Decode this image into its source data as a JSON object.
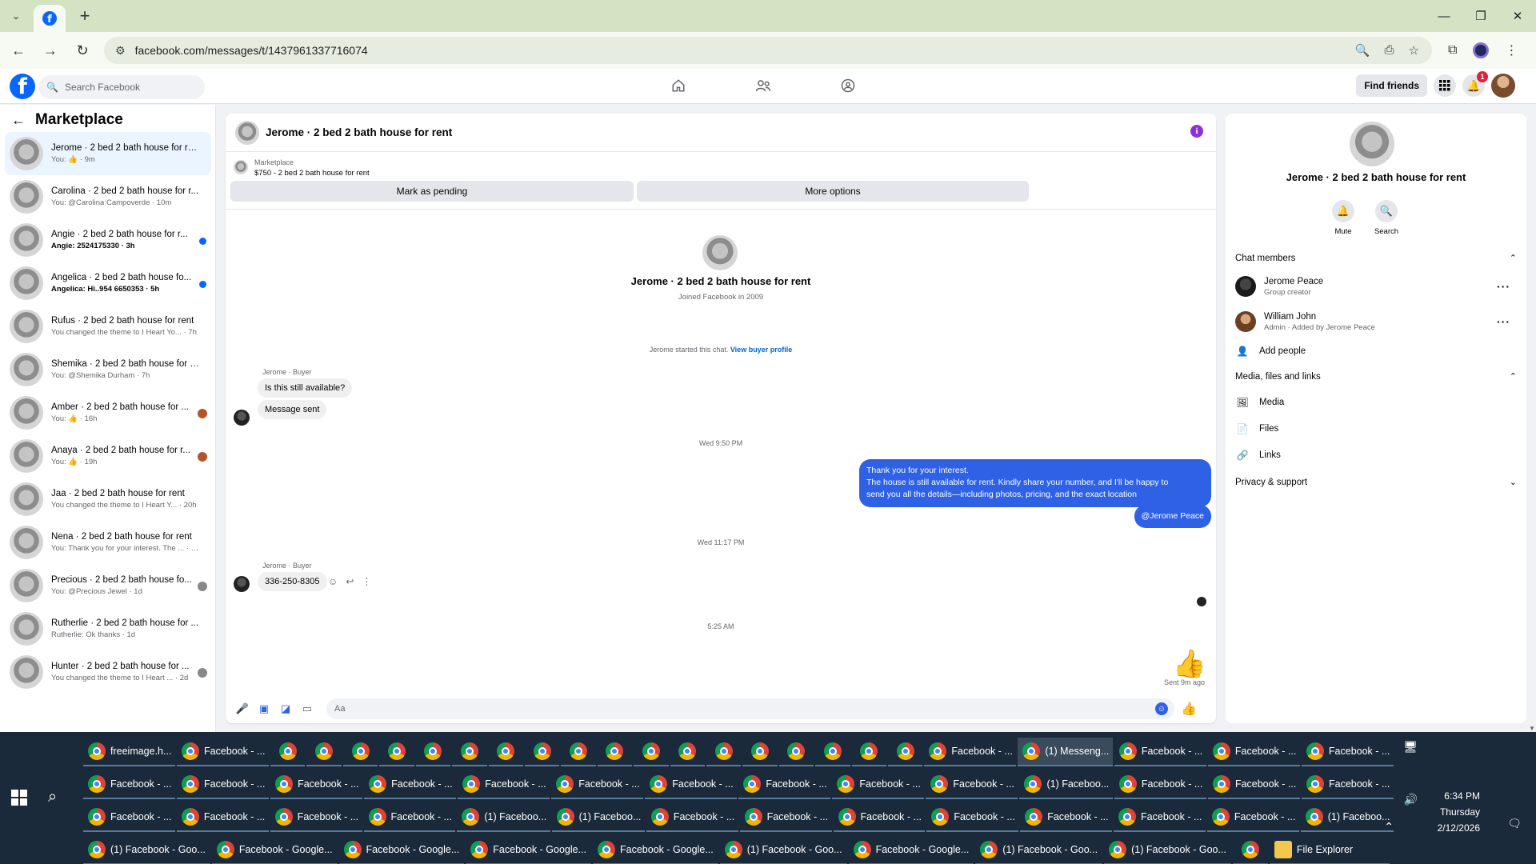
{
  "browser": {
    "url": "facebook.com/messages/t/1437961337716074"
  },
  "fb_header": {
    "search_placeholder": "Search Facebook",
    "find_friends": "Find friends",
    "notif_count": "1"
  },
  "sidebar": {
    "title": "Marketplace",
    "conversations": [
      {
        "name": "Jerome · 2 bed 2 bath house for rent",
        "snippet": "You: 👍 · 9m",
        "unread": false,
        "active": true
      },
      {
        "name": "Carolina · 2 bed 2 bath house for r...",
        "snippet": "You: @Carolina Campoverde · 10m",
        "unread": false
      },
      {
        "name": "Angie · 2 bed 2 bath house for r...",
        "snippet": "Angie: 2524175330 · 3h",
        "unread": true
      },
      {
        "name": "Angelica · 2 bed 2 bath house fo...",
        "snippet": "Angelica: Hi..954 6650353 · 5h",
        "unread": true
      },
      {
        "name": "Rufus · 2 bed 2 bath house for rent",
        "snippet": "You changed the theme to I Heart Yo... · 7h",
        "unread": false
      },
      {
        "name": "Shemika · 2 bed 2 bath house for r...",
        "snippet": "You: @Shemika Durham · 7h",
        "unread": false
      },
      {
        "name": "Amber · 2 bed 2 bath house for ...",
        "snippet": "You: 👍 · 16h",
        "unread": false
      },
      {
        "name": "Anaya · 2 bed 2 bath house for r...",
        "snippet": "You: 👍 · 19h",
        "unread": false
      },
      {
        "name": "Jaa · 2 bed 2 bath house for rent",
        "snippet": "You changed the theme to I Heart Y... · 20h",
        "unread": false
      },
      {
        "name": "Nena · 2 bed 2 bath house for rent",
        "snippet": "You: Thank you for your interest. The ... · 1d",
        "unread": false
      },
      {
        "name": "Precious · 2 bed 2 bath house fo...",
        "snippet": "You: @Precious Jewel · 1d",
        "unread": false
      },
      {
        "name": "Rutherlie · 2 bed 2 bath house for ...",
        "snippet": "Rutherlie: Ok thanks · 1d",
        "unread": false
      },
      {
        "name": "Hunter · 2 bed 2 bath house for ...",
        "snippet": "You changed the theme to I Heart ... · 2d",
        "unread": false
      }
    ]
  },
  "chat": {
    "title": "Jerome · 2 bed 2 bath house for rent",
    "marketplace_label": "Marketplace",
    "listing": "$750 - 2 bed 2 bath house for rent",
    "mark_pending": "Mark as pending",
    "more_options": "More options",
    "intro_name": "Jerome · 2 bed 2 bath house for rent",
    "intro_sub": "Joined Facebook in 2009",
    "started_text": "Jerome started this chat.",
    "view_profile": "View buyer profile",
    "sender_label_1": "Jerome · Buyer",
    "msg_1": "Is this still available?",
    "msg_2": "Message sent",
    "ts_1": "Wed 9:50 PM",
    "out_line1": "Thank you for your interest.",
    "out_line2": "The house is still available for rent. Kindly share your number, and I'll be happy to",
    "out_line3": "send you all the details—including photos, pricing, and the exact location",
    "out_mention": "@Jerome Peace",
    "ts_2": "Wed 11:17 PM",
    "sender_label_2": "Jerome · Buyer",
    "msg_3": "336-250-8305",
    "ts_3": "5:25 AM",
    "sent_label": "Sent 9m ago",
    "composer_placeholder": "Aa"
  },
  "right_panel": {
    "name": "Jerome · 2 bed 2 bath house for rent",
    "mute": "Mute",
    "search": "Search",
    "chat_members": "Chat members",
    "member1_name": "Jerome Peace",
    "member1_role": "Group creator",
    "member2_name": "William John",
    "member2_role": "Admin · Added by Jerome Peace",
    "add_people": "Add people",
    "media_files_links": "Media, files and links",
    "media": "Media",
    "files": "Files",
    "links": "Links",
    "privacy": "Privacy & support"
  },
  "taskbar": {
    "row1": [
      "freeimage.h...",
      "Facebook - ...",
      "",
      "",
      "",
      "",
      "",
      "",
      "",
      "",
      "",
      "",
      "",
      "",
      "",
      "",
      "",
      "",
      "",
      "",
      "Facebook - ...",
      "(1) Messeng...",
      "Facebook - ...",
      "Facebook - ...",
      "Facebook - ..."
    ],
    "row2": [
      "Facebook - ...",
      "Facebook - ...",
      "Facebook - ...",
      "Facebook - ...",
      "Facebook - ...",
      "Facebook - ...",
      "Facebook - ...",
      "Facebook - ...",
      "Facebook - ...",
      "Facebook - ...",
      "(1) Faceboo...",
      "Facebook - ...",
      "Facebook - ...",
      "Facebook - ..."
    ],
    "row3": [
      "Facebook - ...",
      "Facebook - ...",
      "Facebook - ...",
      "Facebook - ...",
      "(1) Faceboo...",
      "(1) Faceboo...",
      "Facebook - ...",
      "Facebook - ...",
      "Facebook - ...",
      "Facebook - ...",
      "Facebook - ...",
      "Facebook - ...",
      "Facebook - ...",
      "(1) Faceboo..."
    ],
    "row4": [
      "(1) Facebook - Goo...",
      "Facebook - Google...",
      "Facebook - Google...",
      "Facebook - Google...",
      "Facebook - Google...",
      "(1) Facebook - Goo...",
      "Facebook - Google...",
      "(1) Facebook - Goo...",
      "(1) Facebook - Goo...",
      "",
      "File Explorer"
    ],
    "time": "6:34 PM",
    "day": "Thursday",
    "date": "2/12/2026"
  }
}
